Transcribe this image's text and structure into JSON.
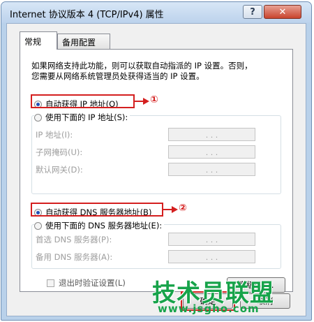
{
  "window": {
    "title": "Internet 协议版本 4 (TCP/IPv4) 属性",
    "help_label": "?",
    "close_label": "✕"
  },
  "tabs": [
    {
      "label": "常规",
      "active": true
    },
    {
      "label": "备用配置",
      "active": false
    }
  ],
  "description_line1": "如果网络支持此功能，则可以获取自动指派的 IP 设置。否则，",
  "description_line2": "您需要从网络系统管理员处获得适当的 IP 设置。",
  "ip_section": {
    "auto_label": "自动获得 IP 地址(O)",
    "auto_selected": true,
    "manual_label": "使用下面的 IP 地址(S):",
    "fields": [
      {
        "label": "IP 地址(I):"
      },
      {
        "label": "子网掩码(U):"
      },
      {
        "label": "默认网关(D):"
      }
    ]
  },
  "dns_section": {
    "auto_label": "自动获得 DNS 服务器地址(B)",
    "auto_selected": true,
    "manual_label": "使用下面的 DNS 服务器地址(E):",
    "fields": [
      {
        "label": "首选 DNS 服务器(P):"
      },
      {
        "label": "备用 DNS 服务器(A):"
      }
    ]
  },
  "validate_label": "退出时验证设置(L)",
  "advanced_button": "高级(V)...",
  "ok_button": "确定",
  "cancel_button": "取消",
  "annotations": {
    "marker1": "①",
    "marker2": "②",
    "highlight_color": "#d41f1f"
  },
  "watermark": {
    "text": "技术员联盟",
    "url": "www.jsgho.com",
    "color": "#17a34a"
  },
  "ip_dots": ". . .",
  "icons": [
    "radio-selected-icon",
    "radio-unselected-icon",
    "checkbox-icon",
    "arrow-right-icon"
  ]
}
